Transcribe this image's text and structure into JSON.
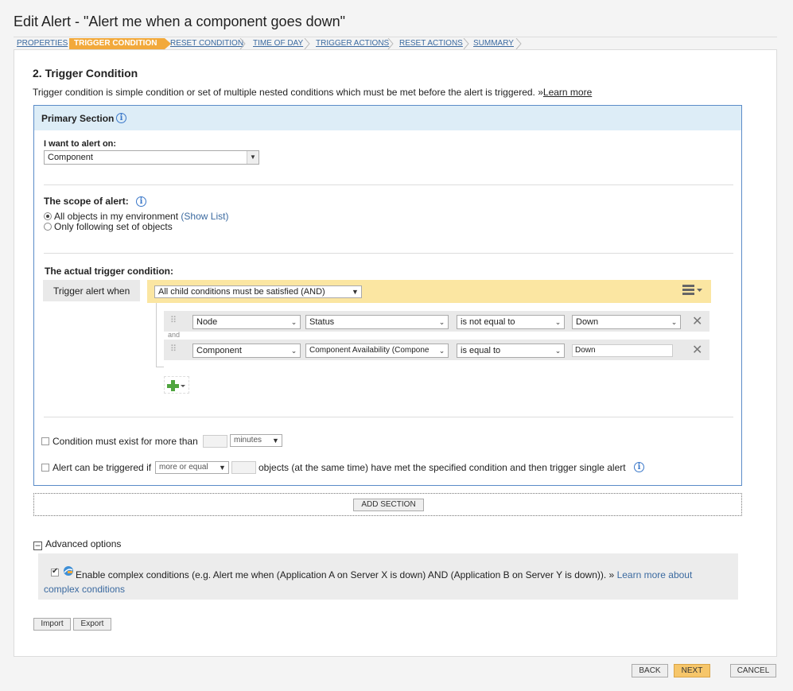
{
  "page_title": "Edit Alert - \"Alert me when a component goes down\"",
  "wizard_steps": [
    {
      "label": "PROPERTIES",
      "active": false
    },
    {
      "label": "TRIGGER CONDITION",
      "active": true
    },
    {
      "label": "RESET CONDITION",
      "active": false
    },
    {
      "label": "TIME OF DAY",
      "active": false
    },
    {
      "label": "TRIGGER ACTIONS",
      "active": false
    },
    {
      "label": "RESET ACTIONS",
      "active": false
    },
    {
      "label": "SUMMARY",
      "active": false
    }
  ],
  "section": {
    "heading": "2. Trigger Condition",
    "description": "Trigger condition is simple condition or set of multiple nested conditions which must be met before the alert is triggered. »",
    "learn_more": "Learn more"
  },
  "primary": {
    "title": "Primary Section",
    "alert_on_label": "I want to alert on:",
    "alert_on_value": "Component",
    "scope_label": "The scope of alert:",
    "scope_all": "All objects in my environment",
    "scope_show_list": "(Show List)",
    "scope_following": "Only following set of objects",
    "trigger_label": "The actual trigger condition:",
    "trigger_when": "Trigger alert when",
    "group_value": "All child conditions must be satisfied (AND)",
    "and_label": "and",
    "conditions": [
      {
        "object": "Node",
        "field": "Status",
        "operator": "is not equal to",
        "value": "Down"
      },
      {
        "object": "Component",
        "field": "Component Availability (Compone",
        "operator": "is equal to",
        "value": "Down"
      }
    ],
    "exist_label": "Condition must exist for more than",
    "exist_unit": "minutes",
    "triggered_label": "Alert can be triggered if",
    "triggered_op": "more or equal",
    "triggered_suffix": "objects (at the same time) have met the specified condition and then trigger single alert"
  },
  "add_section": "ADD SECTION",
  "advanced": {
    "title": "Advanced options",
    "complex_text": "Enable complex conditions (e.g. Alert me when (Application A on Server X is down) AND (Application B on Server Y is down)). »",
    "complex_link_1": "Learn more about",
    "complex_link_2": "complex conditions"
  },
  "buttons": {
    "import": "Import",
    "export": "Export",
    "back": "BACK",
    "next": "NEXT",
    "cancel": "CANCEL"
  },
  "colors": {
    "accent": "#f2a93b",
    "link": "#3b6aa0",
    "section_border": "#5b8cc8",
    "section_head": "#ddedf7",
    "trigger_bar": "#fbe6a2"
  }
}
